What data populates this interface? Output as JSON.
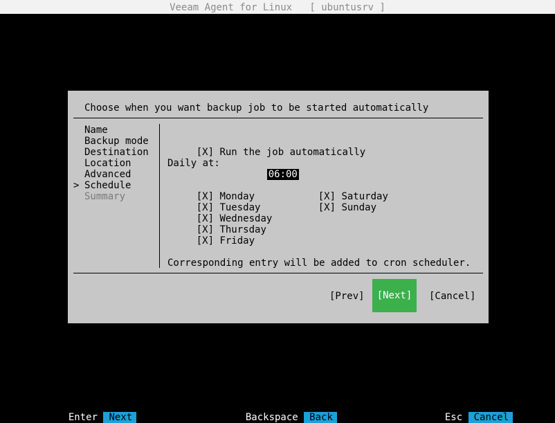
{
  "window": {
    "title": "Veeam Agent for Linux   [ ubuntusrv ]"
  },
  "dialog": {
    "heading": "Choose when you want backup job to be started automatically",
    "steps": [
      {
        "label": "Name",
        "state": "done"
      },
      {
        "label": "Backup mode",
        "state": "done"
      },
      {
        "label": "Destination",
        "state": "done"
      },
      {
        "label": "Location",
        "state": "done"
      },
      {
        "label": "Advanced",
        "state": "done"
      },
      {
        "label": "Schedule",
        "state": "current"
      },
      {
        "label": "Summary",
        "state": "pending"
      }
    ],
    "cursor": ">",
    "run_auto": {
      "mark": "[X]",
      "label": "Run the job automatically"
    },
    "daily": {
      "label": "Daily at:",
      "time": "06:00"
    },
    "days": [
      {
        "mark": "[X]",
        "label": "Monday"
      },
      {
        "mark": "[X]",
        "label": "Tuesday"
      },
      {
        "mark": "[X]",
        "label": "Wednesday"
      },
      {
        "mark": "[X]",
        "label": "Thursday"
      },
      {
        "mark": "[X]",
        "label": "Friday"
      },
      {
        "mark": "[X]",
        "label": "Saturday"
      },
      {
        "mark": "[X]",
        "label": "Sunday"
      }
    ],
    "note": "Corresponding entry will be added to cron scheduler.",
    "buttons": {
      "prev": "[Prev]",
      "next": "[Next]",
      "cancel": "[Cancel]"
    }
  },
  "footer": {
    "enter_key": "Enter",
    "enter_action": "Next",
    "back_key": "Backspace",
    "back_action": "Back",
    "esc_key": "Esc",
    "esc_action": "Cancel"
  },
  "colors": {
    "accent_green": "#3cb04a",
    "key_blue": "#1ba0d8",
    "dialog_bg": "#c7c7c7"
  }
}
